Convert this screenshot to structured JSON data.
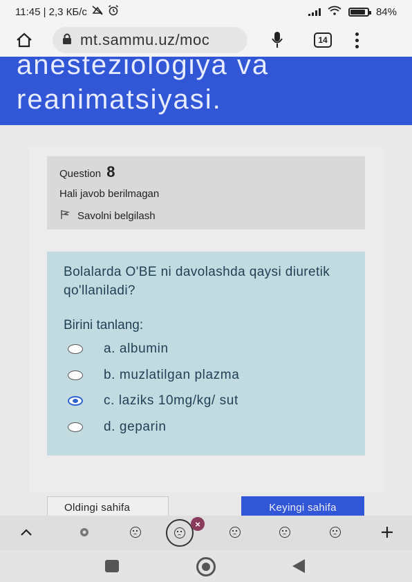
{
  "status_bar": {
    "left_text": "11:45 | 2,3 КБ/с",
    "battery": "84%"
  },
  "browser": {
    "url": "mt.sammu.uz/moc",
    "tab_count": "14",
    "icons": [
      "home-icon",
      "lock-icon",
      "mic-icon",
      "tabs-icon",
      "more-vert-icon"
    ]
  },
  "banner": {
    "title_line1": "anesteziologiya va",
    "title_line2": "reanimatsiyasi."
  },
  "question_info": {
    "label": "Question",
    "number": "8",
    "state": "Hali javob berilmagan",
    "flag_label": "Savolni belgilash"
  },
  "question": {
    "text": "Bolalarda O'BE ni davolashda qaysi diuretik qo'llaniladi?",
    "prompt": "Birini tanlang:",
    "options": [
      {
        "label": "a. albumin",
        "selected": false
      },
      {
        "label": "b. muzlatilgan plazma",
        "selected": false
      },
      {
        "label": "c. laziks 10mg/kg/ sut",
        "selected": true
      },
      {
        "label": "d. geparin",
        "selected": false
      }
    ]
  },
  "navigation": {
    "prev_label": "Oldingi sahifa",
    "next_label": "Keyingi sahifa"
  },
  "keyboard_strip": {
    "icons": [
      "chevron-up-icon",
      "sticker-icon",
      "emoji-icon",
      "emoji-icon",
      "emoji-icon",
      "emoji-icon",
      "emoji-icon",
      "plus-icon"
    ],
    "badge": "×"
  },
  "colors": {
    "banner": "#3156d6",
    "answer_box": "#c2dbe0",
    "selected_radio": "#2e62cf"
  }
}
